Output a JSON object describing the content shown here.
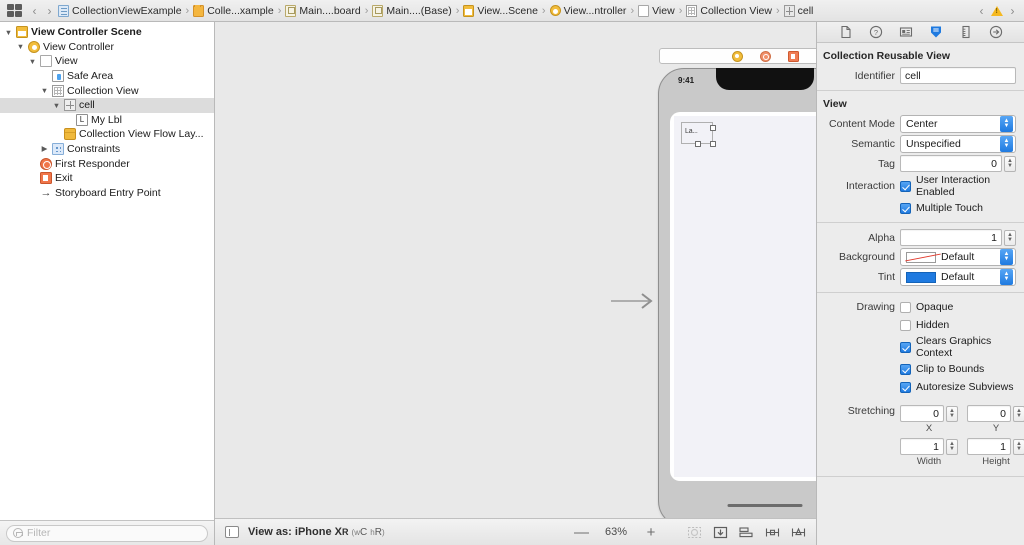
{
  "jumpbar": {
    "grid_icon": "grid-icon",
    "back_arrow": "‹",
    "forward_arrow": "›",
    "crumbs": [
      {
        "label": "CollectionViewExample",
        "icon": "project-document-icon",
        "icon_class": "ci-doc"
      },
      {
        "label": "Colle...xample",
        "icon": "folder-icon",
        "icon_class": "ci-folder"
      },
      {
        "label": "Main....board",
        "icon": "storyboard-file-icon",
        "icon_class": "ci-sb"
      },
      {
        "label": "Main....(Base)",
        "icon": "storyboard-file-icon",
        "icon_class": "ci-sb"
      },
      {
        "label": "View...Scene",
        "icon": "scene-icon",
        "icon_class": "ci-scene"
      },
      {
        "label": "View...ntroller",
        "icon": "view-controller-icon",
        "icon_class": "ci-vc"
      },
      {
        "label": "View",
        "icon": "view-icon",
        "icon_class": "ci-view"
      },
      {
        "label": "Collection View",
        "icon": "collection-view-icon",
        "icon_class": "ci-cv"
      },
      {
        "label": "cell",
        "icon": "collection-cell-icon",
        "icon_class": "ci-cell"
      }
    ],
    "warning_icon": "warning-triangle-icon",
    "sep": "›"
  },
  "navigator": {
    "rows": [
      {
        "label": "View Controller Scene",
        "indent": 0,
        "twisty": "▼",
        "icon": "scene-icon",
        "icon_class": "ri-scene",
        "bold": true,
        "selected": false
      },
      {
        "label": "View Controller",
        "indent": 1,
        "twisty": "▼",
        "icon": "view-controller-icon",
        "icon_class": "ri-vc",
        "bold": false,
        "selected": false
      },
      {
        "label": "View",
        "indent": 2,
        "twisty": "▼",
        "icon": "view-icon",
        "icon_class": "ri-view",
        "bold": false,
        "selected": false
      },
      {
        "label": "Safe Area",
        "indent": 3,
        "twisty": "",
        "icon": "safe-area-icon",
        "icon_class": "ri-safe",
        "bold": false,
        "selected": false
      },
      {
        "label": "Collection View",
        "indent": 3,
        "twisty": "▼",
        "icon": "collection-view-icon",
        "icon_class": "ri-cv",
        "bold": false,
        "selected": false
      },
      {
        "label": "cell",
        "indent": 4,
        "twisty": "▼",
        "icon": "collection-cell-icon",
        "icon_class": "ri-cell",
        "bold": false,
        "selected": true
      },
      {
        "label": "My Lbl",
        "indent": 5,
        "twisty": "",
        "icon": "label-icon",
        "icon_class": "ri-label",
        "icon_text": "L",
        "bold": false,
        "selected": false
      },
      {
        "label": "Collection View Flow Lay...",
        "indent": 4,
        "twisty": "",
        "icon": "flow-layout-icon",
        "icon_class": "ri-flow",
        "bold": false,
        "selected": false
      },
      {
        "label": "Constraints",
        "indent": 3,
        "twisty": "▶",
        "icon": "constraints-icon",
        "icon_class": "ri-constraints",
        "bold": false,
        "selected": false
      },
      {
        "label": "First Responder",
        "indent": 2,
        "twisty": "",
        "icon": "first-responder-icon",
        "icon_class": "ri-fr",
        "bold": false,
        "selected": false
      },
      {
        "label": "Exit",
        "indent": 2,
        "twisty": "",
        "icon": "exit-icon",
        "icon_class": "ri-exit",
        "bold": false,
        "selected": false
      },
      {
        "label": "Storyboard Entry Point",
        "indent": 2,
        "twisty": "",
        "icon": "entry-point-arrow-icon",
        "icon_class": "ri-entry",
        "icon_text": "→",
        "bold": false,
        "selected": false
      }
    ],
    "filter_placeholder": "Filter"
  },
  "canvas": {
    "dock_icons": [
      {
        "name": "view-controller-dock-icon",
        "cls": "dk-vc"
      },
      {
        "name": "first-responder-dock-icon",
        "cls": "dk-fr"
      },
      {
        "name": "exit-dock-icon",
        "cls": "dk-exit"
      }
    ],
    "device": {
      "status_time": "9:41",
      "cell_label": "La...",
      "handles": 4
    }
  },
  "ibbar": {
    "panel_toggle": "left-panel-toggle",
    "view_as_prefix": "View as:",
    "device_name": "iPhone X",
    "device_suffix": "R",
    "traits_open": "(",
    "trait_w": "w",
    "trait_c": "C",
    "trait_h": "h",
    "trait_r": "R",
    "traits_close": ")",
    "zoom_out": "—",
    "zoom_value": "63%",
    "zoom_in": "+",
    "tools": [
      "update-frames-icon",
      "embed-in-icon",
      "align-icon",
      "add-new-constraints-icon",
      "resolve-auto-layout-issues-icon"
    ]
  },
  "inspector": {
    "tabs": [
      "file-inspector-icon",
      "quick-help-inspector-icon",
      "identity-inspector-icon",
      "attributes-inspector-icon",
      "size-inspector-icon",
      "connections-inspector-icon"
    ],
    "active_tab_index": 3,
    "accent_color": "#1f7ae0",
    "reusable_view": {
      "section_title": "Collection Reusable View",
      "identifier_label": "Identifier",
      "identifier_value": "cell"
    },
    "view": {
      "section_title": "View",
      "content_mode_label": "Content Mode",
      "content_mode_value": "Center",
      "semantic_label": "Semantic",
      "semantic_value": "Unspecified",
      "tag_label": "Tag",
      "tag_value": "0",
      "interaction_label": "Interaction",
      "user_interaction_enabled_label": "User Interaction Enabled",
      "user_interaction_enabled": true,
      "multiple_touch_label": "Multiple Touch",
      "multiple_touch": true,
      "alpha_label": "Alpha",
      "alpha_value": "1",
      "background_label": "Background",
      "background_value": "Default",
      "tint_label": "Tint",
      "tint_value": "Default",
      "drawing_label": "Drawing",
      "opaque_label": "Opaque",
      "opaque": false,
      "hidden_label": "Hidden",
      "hidden": false,
      "clears_graphics_label": "Clears Graphics Context",
      "clears_graphics": true,
      "clip_to_bounds_label": "Clip to Bounds",
      "clip_to_bounds": true,
      "autoresize_subviews_label": "Autoresize Subviews",
      "autoresize_subviews": true,
      "stretching_label": "Stretching",
      "stretch_x_value": "0",
      "stretch_x_label": "X",
      "stretch_y_value": "0",
      "stretch_y_label": "Y",
      "stretch_w_value": "1",
      "stretch_w_label": "Width",
      "stretch_h_value": "1",
      "stretch_h_label": "Height"
    }
  }
}
